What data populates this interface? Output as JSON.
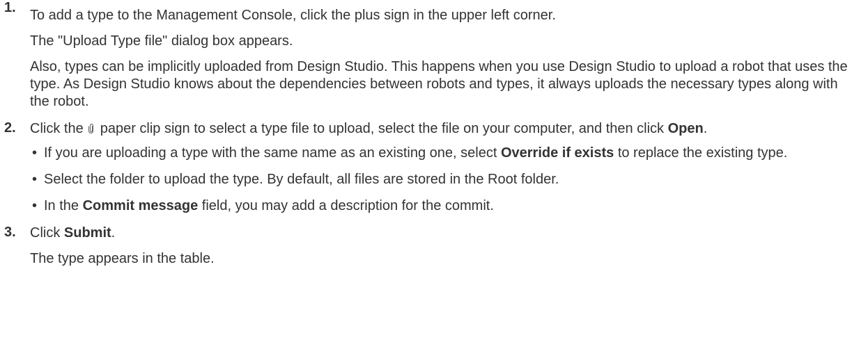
{
  "steps": [
    {
      "number": "1.",
      "lines": [
        "To add a type to the Management Console, click the plus sign in the upper left corner.",
        "The \"Upload Type file\" dialog box appears.",
        "Also, types can be implicitly uploaded from Design Studio. This happens when you use Design Studio to upload a robot that uses the type. As Design Studio knows about the dependencies between robots and types, it always uploads the necessary types along with the robot."
      ]
    },
    {
      "number": "2.",
      "text_before_icon": "Click the",
      "icon": "paper-clip-icon",
      "text_after_icon": "paper clip sign to select a type file to upload, select the file on your computer, and then click ",
      "bold": "Open",
      "text_end": ".",
      "bullets": [
        {
          "before": "If you are uploading a type with the same name as an existing one, select ",
          "bold": "Override if exists",
          "after": " to replace the existing type."
        },
        {
          "before": "Select the folder to upload the type. By default, all files are stored in the Root folder.",
          "bold": "",
          "after": ""
        },
        {
          "before": "In the ",
          "bold": "Commit message",
          "after": " field, you may add a description for the commit."
        }
      ]
    },
    {
      "number": "3.",
      "before": "Click ",
      "bold": "Submit",
      "after": ".",
      "line2": "The type appears in the table."
    }
  ],
  "bullet_char": "•"
}
